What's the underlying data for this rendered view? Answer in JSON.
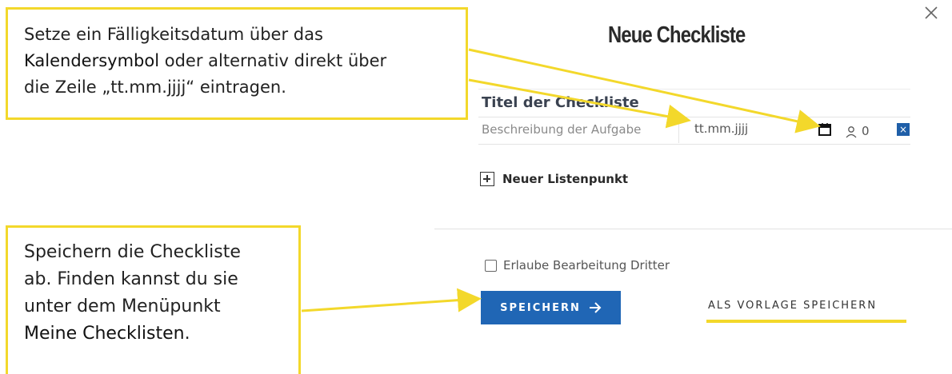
{
  "modal": {
    "title": "Neue Checkliste",
    "close_icon": "close-icon"
  },
  "task": {
    "title": "Titel der Checkliste",
    "description_placeholder": "Beschreibung der Aufgabe",
    "date_prefix": "tt.mm.",
    "date_suffix": "jjjj",
    "calendar_icon": "calendar-icon",
    "user_icon": "user-icon",
    "assignee_count": "0",
    "remove_label": "×"
  },
  "add_item": {
    "label": "Neuer Listenpunkt",
    "icon": "plus-box-icon"
  },
  "permissions": {
    "allow_label": "Erlaube Bearbeitung Dritter",
    "checked": false
  },
  "actions": {
    "save_label": "SPEICHERN",
    "save_arrow": "arrow-right-icon",
    "template_label": "ALS VORLAGE SPEICHERN"
  },
  "callouts": {
    "date_hint": {
      "part1": "Setze ein Fälligkeitsdatum über das",
      "highlight": "Kalendersymbol",
      "part2": "oder alternativ direkt über",
      "part3": "die Zeile „tt.mm.jjjj“ eintragen."
    },
    "save_hint": {
      "line1": "Speichern die Checkliste",
      "line2": "ab. Finden kannst du sie",
      "line3": "unter dem Menüpunkt",
      "highlight": "Meine Checklisten",
      "end": "."
    }
  },
  "colors": {
    "accent_yellow": "#f3d82b",
    "primary_blue": "#2066b5"
  }
}
